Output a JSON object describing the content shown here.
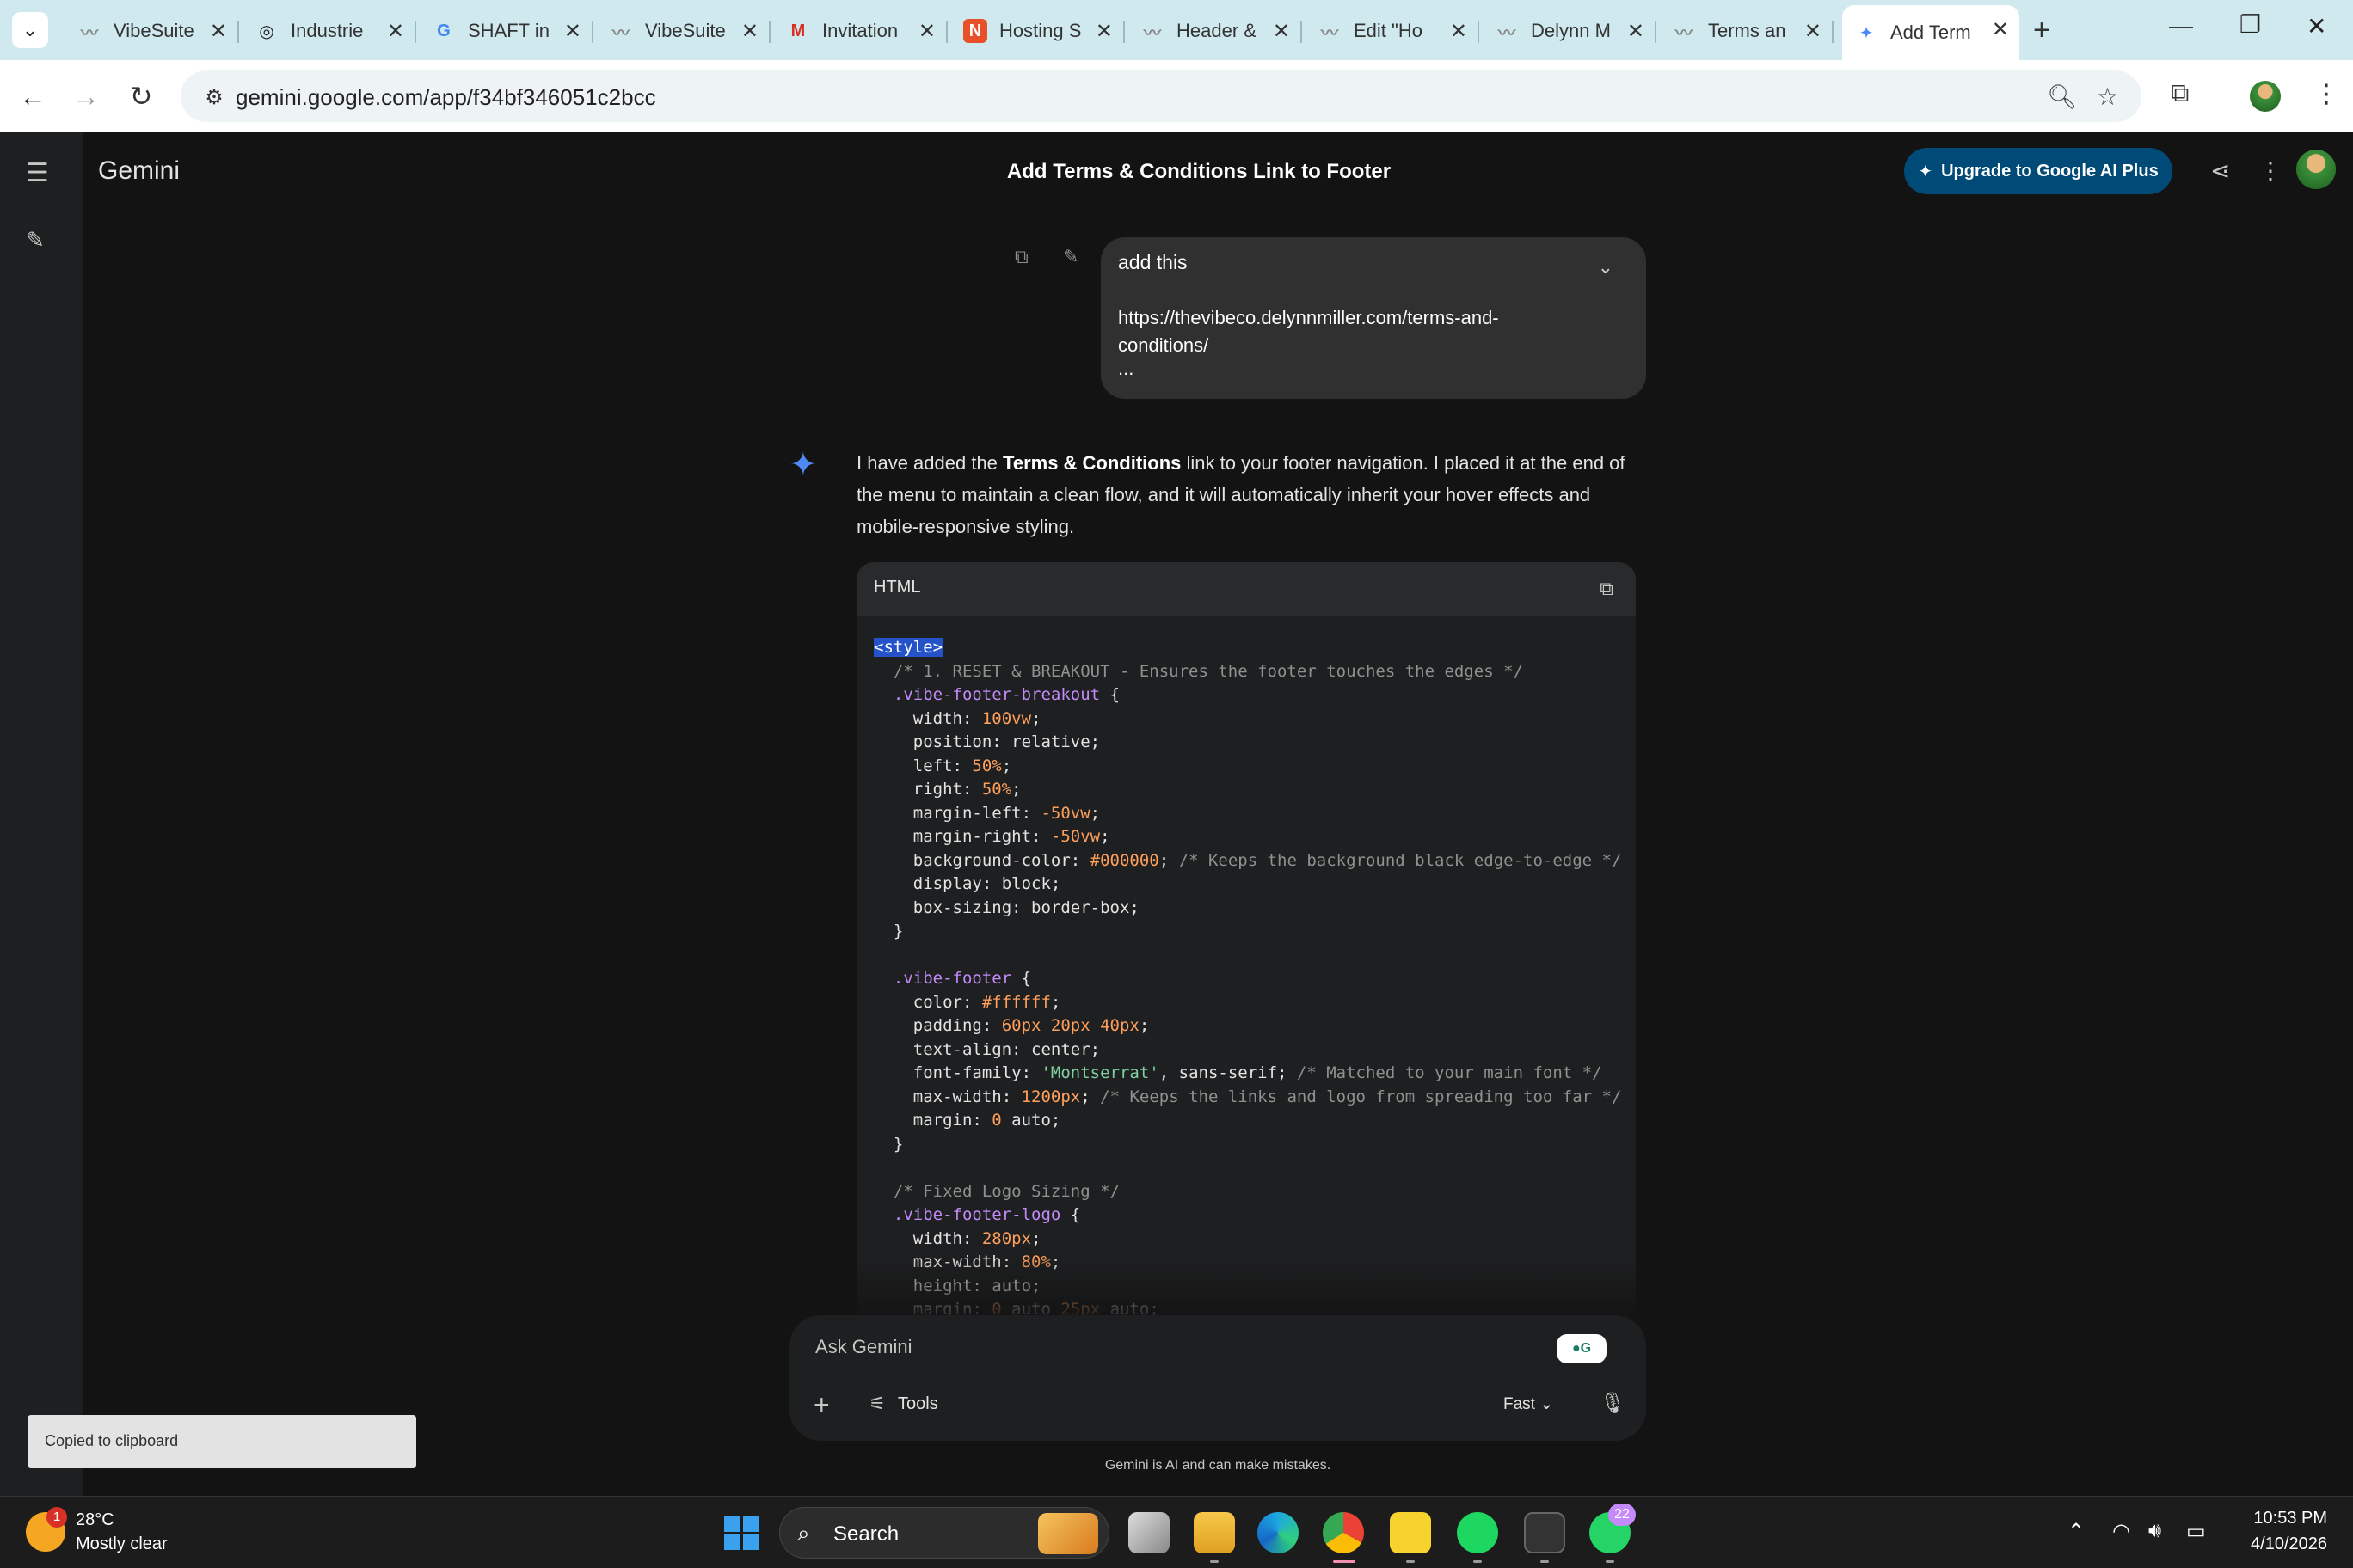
{
  "browser": {
    "tabs": [
      {
        "title": "VibeSuite",
        "icon": "vibesuite-icon"
      },
      {
        "title": "Industrie",
        "icon": "openai-icon"
      },
      {
        "title": "SHAFT in",
        "icon": "google-icon"
      },
      {
        "title": "VibeSuite",
        "icon": "vibesuite-icon"
      },
      {
        "title": "Invitation",
        "icon": "gmail-icon"
      },
      {
        "title": "Hosting S",
        "icon": "hosting-icon"
      },
      {
        "title": "Header &",
        "icon": "vibesuite-icon"
      },
      {
        "title": "Edit \"Ho",
        "icon": "vibesuite-icon"
      },
      {
        "title": "Delynn M",
        "icon": "vibesuite-icon"
      },
      {
        "title": "Terms an",
        "icon": "vibesuite-icon"
      },
      {
        "title": "Add Term",
        "icon": "gemini-icon",
        "active": true
      }
    ],
    "url": "gemini.google.com/app/f34bf346051c2bcc"
  },
  "app": {
    "brand": "Gemini",
    "conversation_title": "Add Terms & Conditions Link to Footer",
    "upgrade_label": "Upgrade to Google AI Plus"
  },
  "user_message": {
    "text": "add this",
    "link": "https://thevibeco.delynnmiller.com/terms-and-conditions/",
    "ellipsis": "..."
  },
  "response": {
    "intro_1": "I have added the ",
    "intro_bold": "Terms & Conditions",
    "intro_2": " link to your footer navigation. I placed it at the end of the menu to maintain a clean flow, and it will automatically inherit your hover effects and mobile-responsive styling.",
    "code_language": "HTML",
    "code_lines": [
      [
        {
          "t": "<style>",
          "c": "tag"
        }
      ],
      [
        {
          "t": "  /* 1. RESET & BREAKOUT - Ensures the footer touches the edges */",
          "c": "com"
        }
      ],
      [
        {
          "t": "  .vibe-footer-breakout",
          "c": "sel"
        },
        {
          "t": " {",
          "c": ""
        }
      ],
      [
        {
          "t": "    width: ",
          "c": ""
        },
        {
          "t": "100vw",
          "c": "num"
        },
        {
          "t": ";",
          "c": ""
        }
      ],
      [
        {
          "t": "    position: relative;",
          "c": ""
        }
      ],
      [
        {
          "t": "    left: ",
          "c": ""
        },
        {
          "t": "50%",
          "c": "num"
        },
        {
          "t": ";",
          "c": ""
        }
      ],
      [
        {
          "t": "    right: ",
          "c": ""
        },
        {
          "t": "50%",
          "c": "num"
        },
        {
          "t": ";",
          "c": ""
        }
      ],
      [
        {
          "t": "    margin-left: ",
          "c": ""
        },
        {
          "t": "-50vw",
          "c": "num"
        },
        {
          "t": ";",
          "c": ""
        }
      ],
      [
        {
          "t": "    margin-right: ",
          "c": ""
        },
        {
          "t": "-50vw",
          "c": "num"
        },
        {
          "t": ";",
          "c": ""
        }
      ],
      [
        {
          "t": "    background-color: ",
          "c": ""
        },
        {
          "t": "#000000",
          "c": "num"
        },
        {
          "t": "; ",
          "c": ""
        },
        {
          "t": "/* Keeps the background black edge-to-edge */",
          "c": "com"
        }
      ],
      [
        {
          "t": "    display: block;",
          "c": ""
        }
      ],
      [
        {
          "t": "    box-sizing: border-box;",
          "c": ""
        }
      ],
      [
        {
          "t": "  }",
          "c": ""
        }
      ],
      [
        {
          "t": "",
          "c": ""
        }
      ],
      [
        {
          "t": "  .vibe-footer",
          "c": "sel"
        },
        {
          "t": " {",
          "c": ""
        }
      ],
      [
        {
          "t": "    color: ",
          "c": ""
        },
        {
          "t": "#ffffff",
          "c": "num"
        },
        {
          "t": ";",
          "c": ""
        }
      ],
      [
        {
          "t": "    padding: ",
          "c": ""
        },
        {
          "t": "60px 20px 40px",
          "c": "num"
        },
        {
          "t": ";",
          "c": ""
        }
      ],
      [
        {
          "t": "    text-align: center;",
          "c": ""
        }
      ],
      [
        {
          "t": "    font-family: ",
          "c": ""
        },
        {
          "t": "'Montserrat'",
          "c": "str"
        },
        {
          "t": ", sans-serif; ",
          "c": ""
        },
        {
          "t": "/* Matched to your main font */",
          "c": "com"
        }
      ],
      [
        {
          "t": "    max-width: ",
          "c": ""
        },
        {
          "t": "1200px",
          "c": "num"
        },
        {
          "t": "; ",
          "c": ""
        },
        {
          "t": "/* Keeps the links and logo from spreading too far */",
          "c": "com"
        }
      ],
      [
        {
          "t": "    margin: ",
          "c": ""
        },
        {
          "t": "0",
          "c": "num"
        },
        {
          "t": " auto;",
          "c": ""
        }
      ],
      [
        {
          "t": "  }",
          "c": ""
        }
      ],
      [
        {
          "t": "",
          "c": ""
        }
      ],
      [
        {
          "t": "  /* Fixed Logo Sizing */",
          "c": "com"
        }
      ],
      [
        {
          "t": "  .vibe-footer-logo",
          "c": "sel"
        },
        {
          "t": " {",
          "c": ""
        }
      ],
      [
        {
          "t": "    width: ",
          "c": ""
        },
        {
          "t": "280px",
          "c": "num"
        },
        {
          "t": ";",
          "c": ""
        }
      ],
      [
        {
          "t": "    max-width: ",
          "c": ""
        },
        {
          "t": "80%",
          "c": "num"
        },
        {
          "t": ";",
          "c": ""
        }
      ],
      [
        {
          "t": "    height: auto;",
          "c": ""
        }
      ],
      [
        {
          "t": "    margin: ",
          "c": ""
        },
        {
          "t": "0",
          "c": "num"
        },
        {
          "t": " auto ",
          "c": ""
        },
        {
          "t": "25px",
          "c": "num"
        },
        {
          "t": " auto;",
          "c": ""
        }
      ]
    ]
  },
  "input": {
    "placeholder": "Ask Gemini",
    "tools_label": "Tools",
    "mode_label": "Fast",
    "disclaimer": "Gemini is AI and can make mistakes."
  },
  "toast": "Copied to clipboard",
  "taskbar": {
    "weather_badge": "1",
    "temperature": "28°C",
    "condition": "Mostly clear",
    "search_label": "Search",
    "whatsapp_badge": "22",
    "time": "10:53 PM",
    "date": "4/10/2026"
  },
  "colors": {
    "accent": "#004a77",
    "gemini_blue": "#4e8af5",
    "background": "#131314"
  }
}
